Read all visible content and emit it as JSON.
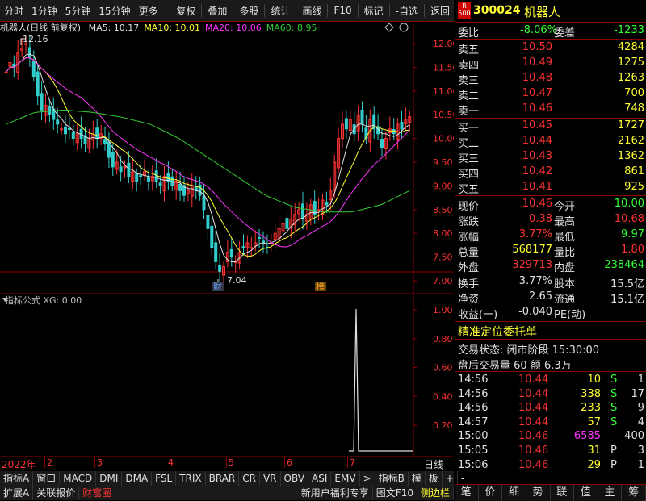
{
  "toolbar": {
    "left": [
      "分时",
      "1分钟",
      "5分钟",
      "15分钟",
      "更多"
    ],
    "right": [
      "复权",
      "叠加",
      "多股",
      "统计",
      "画线",
      "F10",
      "标记",
      "-自选",
      "返回"
    ]
  },
  "chart": {
    "title": "机器人(日线 前复权)",
    "ma": [
      {
        "label": "MA5: 10.17",
        "color": "#e0e0e0"
      },
      {
        "label": "MA10: 10.01",
        "color": "#ffff33"
      },
      {
        "label": "MA20: 10.06",
        "color": "#ff33ff"
      },
      {
        "label": "MA60: 8.95",
        "color": "#33cc33"
      }
    ],
    "y_labels": [
      "12.00",
      "11.50",
      "11.00",
      "10.50",
      "10.00",
      "9.50",
      "9.00",
      "8.50",
      "8.00",
      "7.50",
      "7.00"
    ],
    "high_note": "12.16",
    "low_note": "7.04",
    "marker_cai": "财",
    "marker_bang": "榜",
    "colors": {
      "up": "#ff3333",
      "down": "#33cccc",
      "ma5": "#e0e0e0",
      "ma10": "#ffff33",
      "ma20": "#ff33ff",
      "ma60": "#33cc33",
      "grid": "#8b0000"
    }
  },
  "indicator": {
    "title": "指标公式  XG: 0.00",
    "y_labels": [
      "1.00",
      "0.80",
      "0.60",
      "0.40",
      "0.20"
    ]
  },
  "xaxis": {
    "year": "2022年",
    "months": [
      "2",
      "3",
      "4",
      "5",
      "6",
      "7"
    ],
    "period": "日线"
  },
  "bottom": {
    "row1": [
      "指标A",
      "窗口",
      "MACD",
      "DMI",
      "DMA",
      "FSL",
      "TRIX",
      "BRAR",
      "CR",
      "VR",
      "OBV",
      "ASI",
      "EMV",
      ">"
    ],
    "row1_right": [
      "指标B",
      "模",
      "板",
      "+",
      "-"
    ],
    "row2": [
      "扩展A",
      "关联报价",
      "财富圈"
    ],
    "row2_right": [
      "新用户福利专享",
      "图文F10",
      "侧边栏"
    ]
  },
  "stock": {
    "badge_top": "R",
    "badge_bottom": "500",
    "code": "300024",
    "name": "机器人"
  },
  "quote": {
    "webi_label": "委比",
    "webi": "-8.06%",
    "weicha_label": "委差",
    "weicha": "-1233",
    "asks": [
      {
        "label": "卖五",
        "price": "10.50",
        "vol": "4284"
      },
      {
        "label": "卖四",
        "price": "10.49",
        "vol": "1275"
      },
      {
        "label": "卖三",
        "price": "10.48",
        "vol": "1263"
      },
      {
        "label": "卖二",
        "price": "10.47",
        "vol": "700"
      },
      {
        "label": "卖一",
        "price": "10.46",
        "vol": "748"
      }
    ],
    "bids": [
      {
        "label": "买一",
        "price": "10.45",
        "vol": "1727"
      },
      {
        "label": "买二",
        "price": "10.44",
        "vol": "2162"
      },
      {
        "label": "买三",
        "price": "10.43",
        "vol": "1362"
      },
      {
        "label": "买四",
        "price": "10.42",
        "vol": "861"
      },
      {
        "label": "买五",
        "price": "10.41",
        "vol": "925"
      }
    ],
    "stats": [
      {
        "l1": "现价",
        "v1": "10.46",
        "c1": "red",
        "l2": "今开",
        "v2": "10.00",
        "c2": "green"
      },
      {
        "l1": "涨跌",
        "v1": "0.38",
        "c1": "red",
        "l2": "最高",
        "v2": "10.68",
        "c2": "red"
      },
      {
        "l1": "涨幅",
        "v1": "3.77%",
        "c1": "red",
        "l2": "最低",
        "v2": "9.97",
        "c2": "green"
      },
      {
        "l1": "总量",
        "v1": "568177",
        "c1": "yellow",
        "l2": "量比",
        "v2": "1.80",
        "c2": "red"
      },
      {
        "l1": "外盘",
        "v1": "329713",
        "c1": "red",
        "l2": "内盘",
        "v2": "238464",
        "c2": "green"
      }
    ],
    "stats2": [
      {
        "l1": "换手",
        "v1": "3.77%",
        "l2": "股本",
        "v2": "15.5亿"
      },
      {
        "l1": "净资",
        "v1": "2.65",
        "l2": "流通",
        "v2": "15.1亿"
      },
      {
        "l1": "收益(一)",
        "v1": "-0.040",
        "l2": "PE(动)",
        "v2": ""
      }
    ]
  },
  "order": {
    "title": "精准定位委托单",
    "status": "交易状态: 闭市阶段 15:30:00",
    "after": "盘后交易量 60 额 6.3万"
  },
  "ticks": [
    {
      "time": "14:56",
      "price": "10.44",
      "vol": "10",
      "bs": "S",
      "n": "1",
      "vc": "yellow",
      "bc": "green"
    },
    {
      "time": "14:56",
      "price": "10.44",
      "vol": "338",
      "bs": "S",
      "n": "17",
      "vc": "yellow",
      "bc": "green"
    },
    {
      "time": "14:56",
      "price": "10.44",
      "vol": "233",
      "bs": "S",
      "n": "9",
      "vc": "yellow",
      "bc": "green"
    },
    {
      "time": "14:57",
      "price": "10.44",
      "vol": "57",
      "bs": "S",
      "n": "4",
      "vc": "yellow",
      "bc": "green"
    },
    {
      "time": "15:00",
      "price": "10.46",
      "vol": "6585",
      "bs": "",
      "n": "400",
      "vc": "magenta",
      "bc": "white"
    },
    {
      "time": "15:05",
      "price": "10.46",
      "vol": "31",
      "bs": "P",
      "n": "3",
      "vc": "yellow",
      "bc": "white"
    },
    {
      "time": "15:06",
      "price": "10.46",
      "vol": "29",
      "bs": "P",
      "n": "1",
      "vc": "yellow",
      "bc": "white"
    }
  ],
  "right_tabs": [
    "笔",
    "价",
    "细",
    "势",
    "联",
    "值",
    "主",
    "筹"
  ]
}
